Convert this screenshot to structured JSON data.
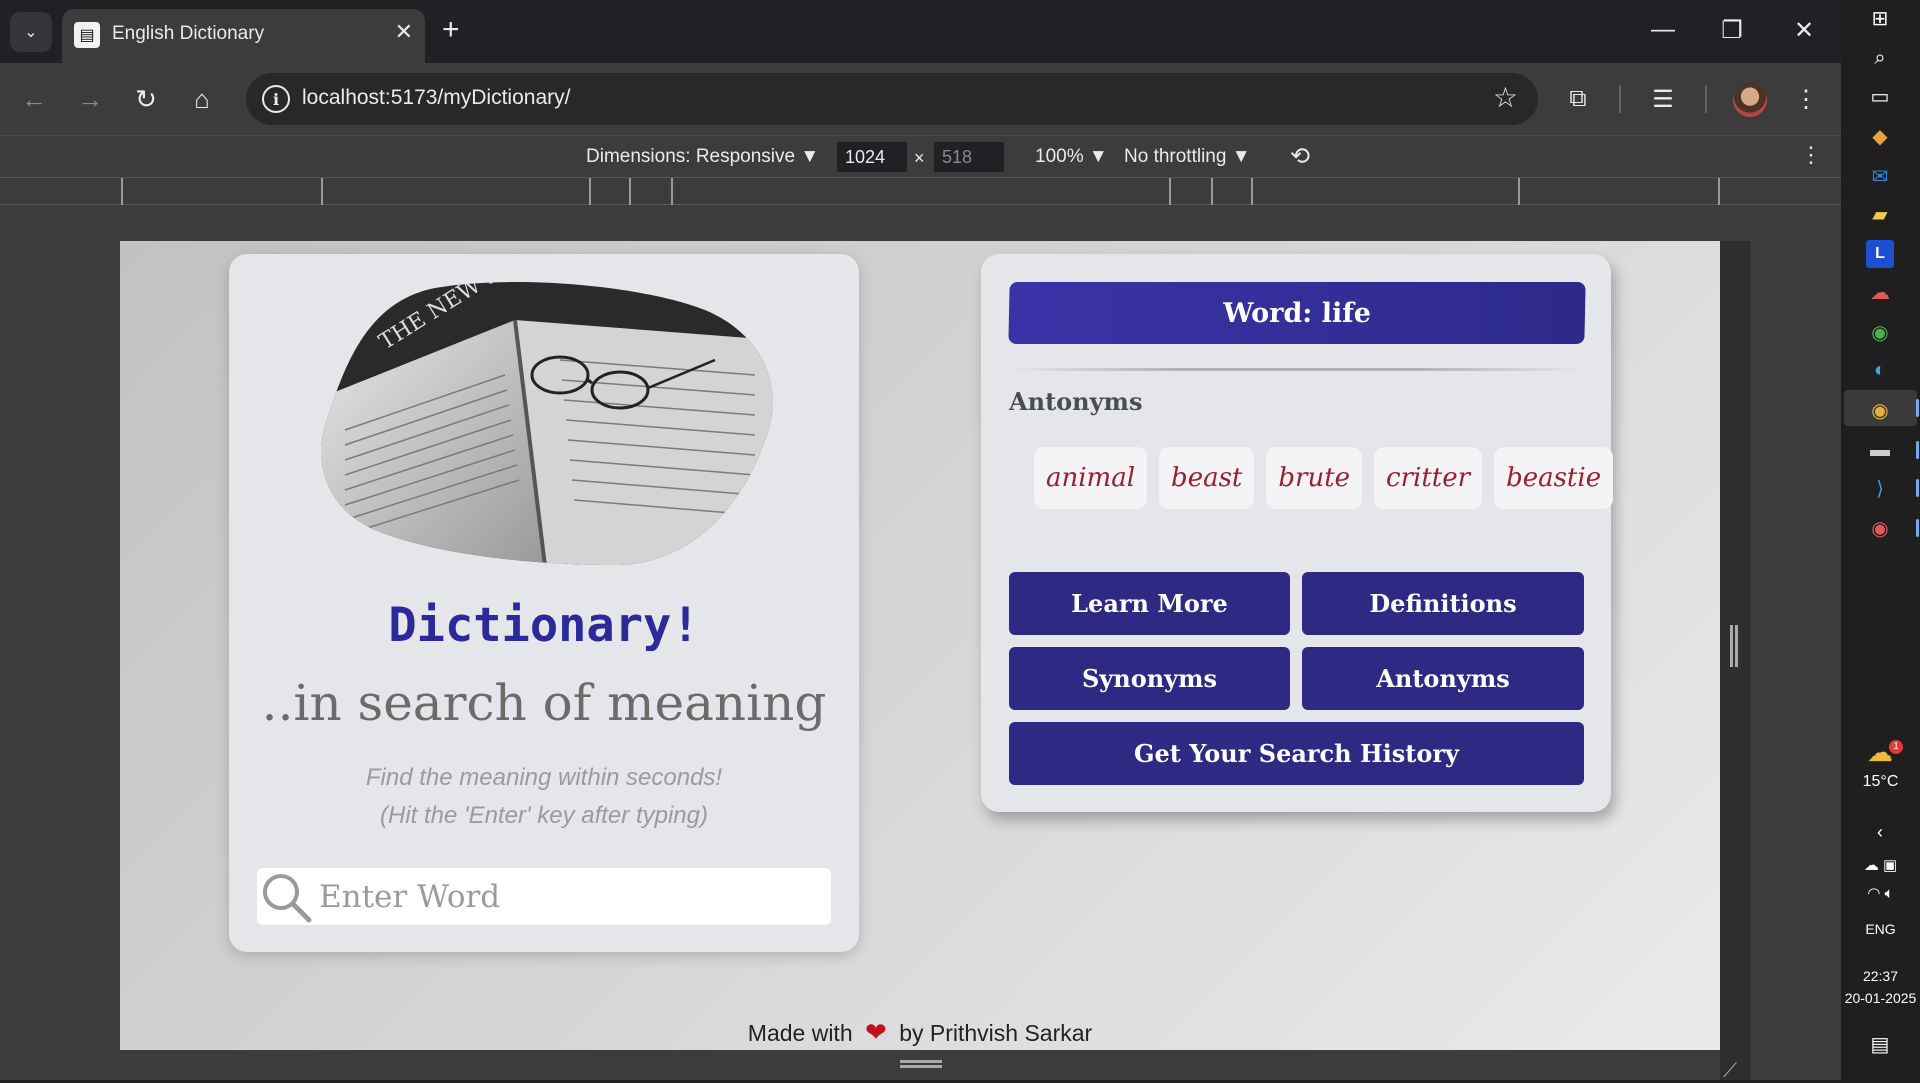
{
  "browser": {
    "tab_title": "English Dictionary",
    "url": "localhost:5173/myDictionary/"
  },
  "devtools": {
    "dimensions_label": "Dimensions: Responsive",
    "width_value": "1024",
    "height_placeholder": "518",
    "zoom_label": "100%",
    "throttling_label": "No throttling"
  },
  "app": {
    "title": "Dictionary!",
    "tagline": "..in search of meaning",
    "hint_line1": "Find the meaning within seconds!",
    "hint_line2": "(Hit the 'Enter' key after typing)",
    "search_placeholder": "Enter Word",
    "image_caption_text": "THE NEW SHORTER OXFORD",
    "word_banner": "Word: life",
    "section_title": "Antonyms",
    "chips": [
      "animal",
      "beast",
      "brute",
      "critter",
      "beastie"
    ],
    "buttons": {
      "learn_more": "Learn More",
      "definitions": "Definitions",
      "synonyms": "Synonyms",
      "antonyms": "Antonyms",
      "history": "Get Your Search History"
    },
    "footer_prefix": "Made with",
    "footer_suffix": "by Prithvish Sarkar"
  },
  "taskbar": {
    "temperature": "15°C",
    "weather_badge": "1",
    "language": "ENG",
    "time": "22:37",
    "date": "20-01-2025"
  },
  "colors": {
    "accent": "#2e2a84",
    "title": "#2c2a9a",
    "chip_text": "#9c1f2e",
    "heart": "#c0111f"
  }
}
